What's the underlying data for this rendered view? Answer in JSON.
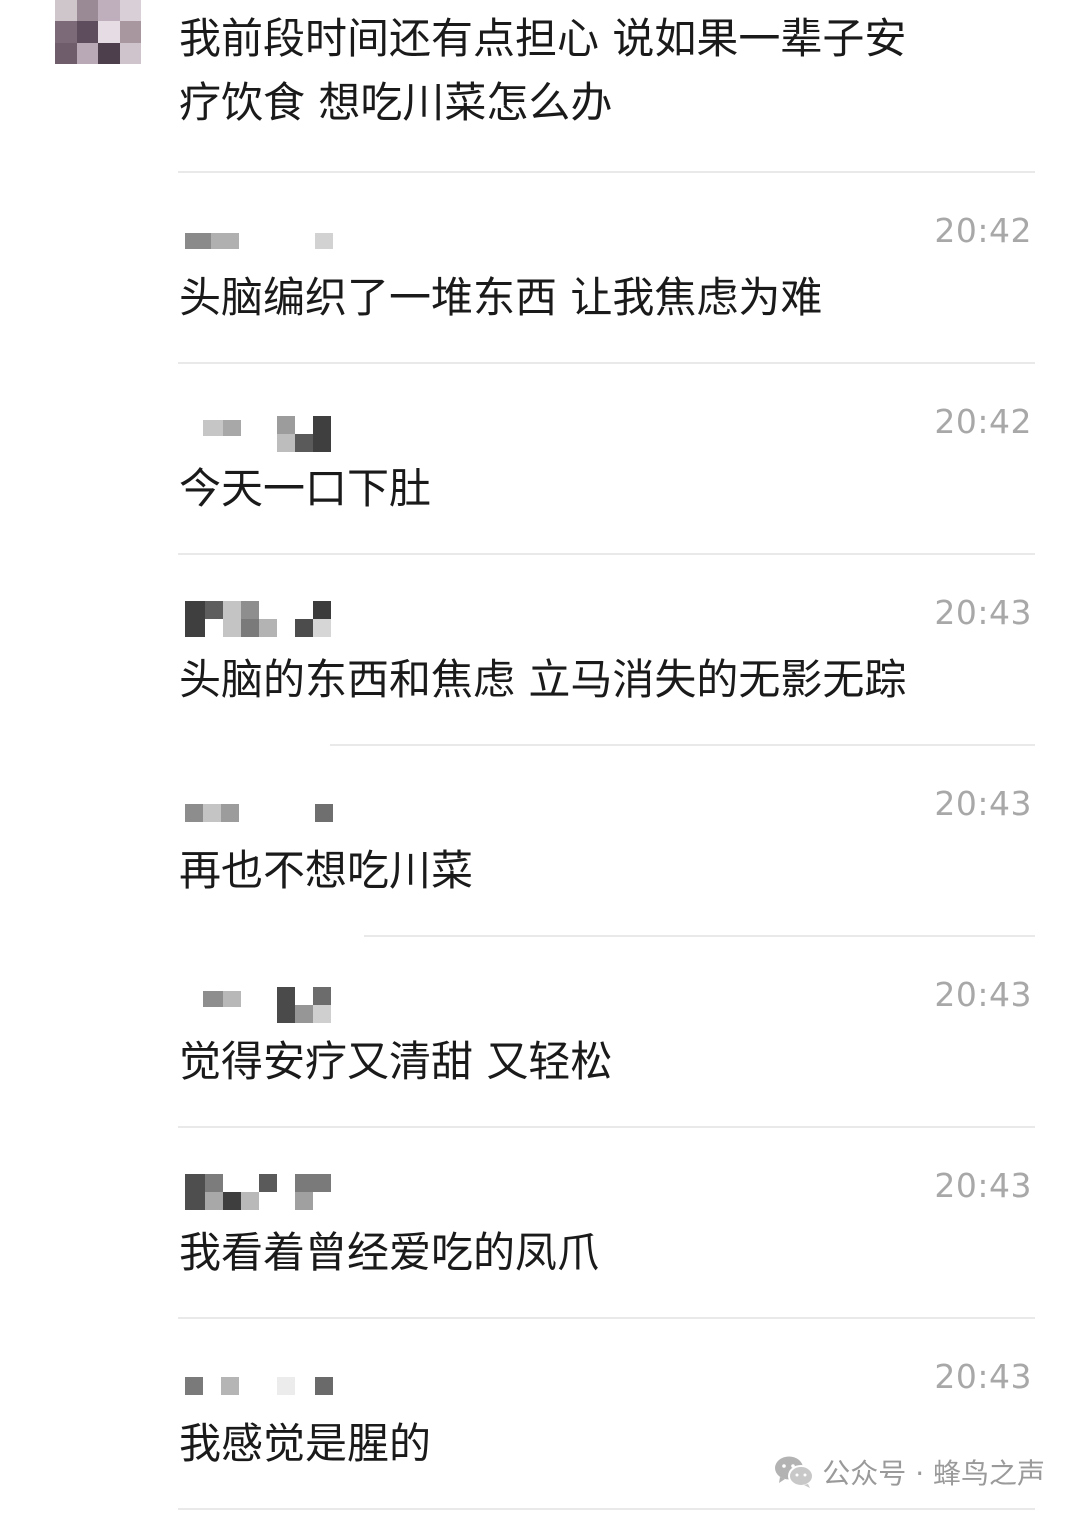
{
  "chat": {
    "first_message": {
      "line1": "我前段时间还有点担心 说如果一辈子安",
      "line2": "疗饮食 想吃川菜怎么办"
    },
    "messages": [
      {
        "time": "20:42",
        "text": "头脑编织了一堆东西 让我焦虑为难"
      },
      {
        "time": "20:42",
        "text": "今天一口下肚"
      },
      {
        "time": "20:43",
        "text": "头脑的东西和焦虑 立马消失的无影无踪"
      },
      {
        "time": "20:43",
        "text": "再也不想吃川菜"
      },
      {
        "time": "20:43",
        "text": "觉得安疗又清甜 又轻松"
      },
      {
        "time": "20:43",
        "text": "我看着曾经爱吃的凤爪"
      },
      {
        "time": "20:43",
        "text": "我感觉是腥的"
      }
    ]
  },
  "watermark": {
    "icon": "wechat-icon",
    "text": "公众号 · 蜂鸟之声"
  },
  "colors": {
    "time": "#a8a8a8",
    "text": "#1a1a1a",
    "divider": "#e9e9e9"
  }
}
